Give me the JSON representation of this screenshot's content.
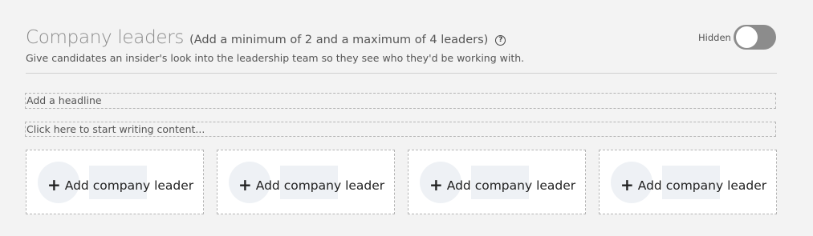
{
  "section": {
    "title": "Company leaders",
    "note": "(Add a minimum of 2 and a maximum of 4 leaders)",
    "description": "Give candidates an insider's look into the leadership team so they see who they'd be working with."
  },
  "visibility_toggle": {
    "label": "Hidden",
    "state": "off"
  },
  "headline_field": {
    "placeholder": "Add a headline"
  },
  "content_field": {
    "placeholder": "Click here to start writing content..."
  },
  "leader_cards": [
    {
      "label": "Add company leader"
    },
    {
      "label": "Add company leader"
    },
    {
      "label": "Add company leader"
    },
    {
      "label": "Add company leader"
    }
  ],
  "icons": {
    "help": "help-circle-icon",
    "add": "plus-icon"
  }
}
